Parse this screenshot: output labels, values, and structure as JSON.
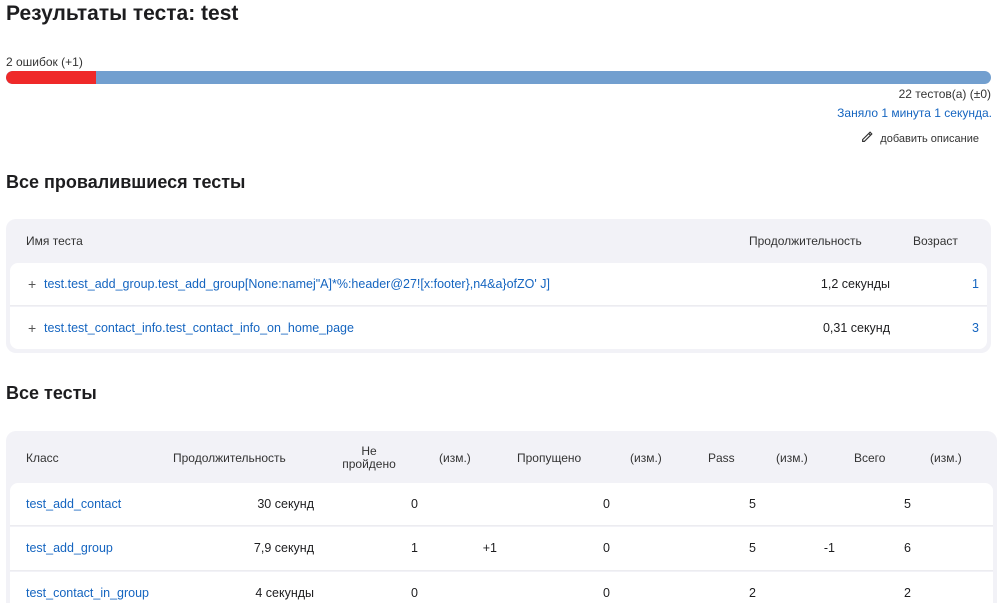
{
  "header": {
    "title": "Результаты теста: test"
  },
  "summary": {
    "failures": "2 ошибок (+1)",
    "fail_fraction": 0.0909,
    "total_tests": "22 тестов(а) (±0)",
    "duration": "Заняло 1 минута 1 секунда.",
    "add_description": "добавить описание"
  },
  "colors": {
    "fail": "#ef2929",
    "pass": "#729fcf",
    "link": "#1565c0",
    "card_bg": "#f2f2f7"
  },
  "failed": {
    "title": "Все провалившиеся тесты",
    "columns": {
      "name": "Имя теста",
      "duration": "Продолжительность",
      "age": "Возраст"
    },
    "rows": [
      {
        "expand": "+",
        "name": "test.test_add_group.test_add_group[None:namej\"A]*%:header@27![x:footer},n4&a}ofZO' J]",
        "duration": "1,2 секунды",
        "age": "1"
      },
      {
        "expand": "+",
        "name": "test.test_contact_info.test_contact_info_on_home_page",
        "duration": "0,31 секунд",
        "age": "3"
      }
    ]
  },
  "all": {
    "title": "Все тесты",
    "columns": {
      "class": "Класс",
      "duration": "Продолжительность",
      "failed": "Не пройдено",
      "failed_diff": "(изм.)",
      "skipped": "Пропущено",
      "skipped_diff": "(изм.)",
      "pass": "Pass",
      "pass_diff": "(изм.)",
      "total": "Всего",
      "total_diff": "(изм.)"
    },
    "rows": [
      {
        "class": "test_add_contact",
        "duration": "30 секунд",
        "failed": "0",
        "failed_diff": "",
        "skipped": "0",
        "skipped_diff": "",
        "pass": "5",
        "pass_diff": "",
        "total": "5",
        "total_diff": ""
      },
      {
        "class": "test_add_group",
        "duration": "7,9 секунд",
        "failed": "1",
        "failed_diff": "+1",
        "skipped": "0",
        "skipped_diff": "",
        "pass": "5",
        "pass_diff": "-1",
        "total": "6",
        "total_diff": ""
      },
      {
        "class": "test_contact_in_group",
        "duration": "4 секунды",
        "failed": "0",
        "failed_diff": "",
        "skipped": "0",
        "skipped_diff": "",
        "pass": "2",
        "pass_diff": "",
        "total": "2",
        "total_diff": ""
      }
    ]
  }
}
